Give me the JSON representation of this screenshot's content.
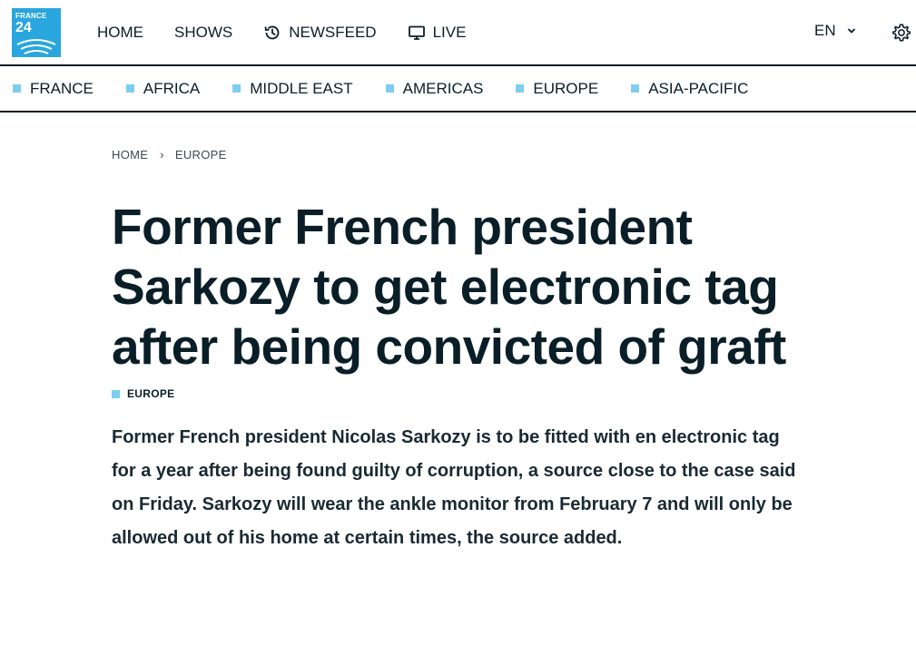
{
  "brand": {
    "logo_line1": "FRANCE",
    "logo_line2": "24",
    "color": "#2aa6de"
  },
  "nav": {
    "home": "HOME",
    "shows": "SHOWS",
    "newsfeed": "NEWSFEED",
    "live": "LIVE",
    "language": "EN"
  },
  "subnav": {
    "items": [
      "FRANCE",
      "AFRICA",
      "MIDDLE EAST",
      "AMERICAS",
      "EUROPE",
      "ASIA-PACIFIC"
    ],
    "accent": "#7dcdf0"
  },
  "breadcrumb": {
    "home": "HOME",
    "separator": "›",
    "section": "EUROPE"
  },
  "article": {
    "title": "Former French president Sarkozy to get electronic tag after being convicted of graft",
    "tag": "EUROPE",
    "lead": "Former French president Nicolas Sarkozy is to be fitted with en electronic tag for a year after being found guilty of corruption, a source close to the case said on Friday. Sarkozy will wear the ankle monitor from February 7 and will only be allowed out of his home at certain times, the source added."
  },
  "icons": {
    "newsfeed": "history-icon",
    "live": "monitor-icon",
    "settings": "gear-icon",
    "language": "chevron-down-icon"
  }
}
